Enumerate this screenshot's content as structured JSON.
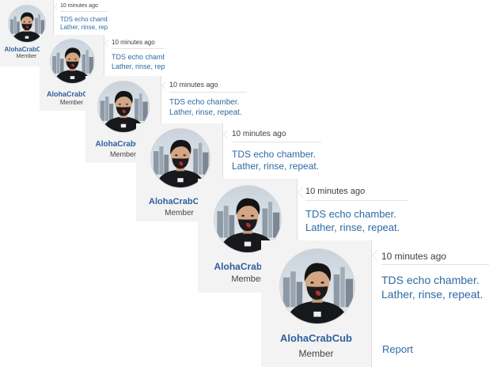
{
  "colors": {
    "link": "#2e6aa3",
    "username": "#2f5f9b",
    "panel_background": "#f3f3f4",
    "border": "#dedede",
    "text_muted": "#3d3d3d"
  },
  "icons": {
    "avatar": "profile-photo-masked-person-city-background"
  },
  "posts": [
    {
      "username": "AlohaCrabCub",
      "role": "Member",
      "timestamp": "10 minutes ago",
      "message_line1": "TDS echo chamber.",
      "message_line2": "Lather, rinse, repeat."
    },
    {
      "username": "AlohaCrabCub",
      "role": "Member",
      "timestamp": "10 minutes ago",
      "message_line1": "TDS echo chamber.",
      "message_line2": "Lather, rinse, repeat."
    },
    {
      "username": "AlohaCrabCub",
      "role": "Member",
      "timestamp": "10 minutes ago",
      "message_line1": "TDS echo chamber.",
      "message_line2": "Lather, rinse, repeat."
    },
    {
      "username": "AlohaCrabCub",
      "role": "Member",
      "timestamp": "10 minutes ago",
      "message_line1": "TDS echo chamber.",
      "message_line2": "Lather, rinse, repeat."
    },
    {
      "username": "AlohaCrabCub",
      "role": "Member",
      "timestamp": "10 minutes ago",
      "message_line1": "TDS echo chamber.",
      "message_line2": "Lather, rinse, repeat."
    },
    {
      "username": "AlohaCrabCub",
      "role": "Member",
      "timestamp": "10 minutes ago",
      "message_line1": "TDS echo chamber.",
      "message_line2": "Lather, rinse, repeat.",
      "report_label": "Report"
    }
  ]
}
